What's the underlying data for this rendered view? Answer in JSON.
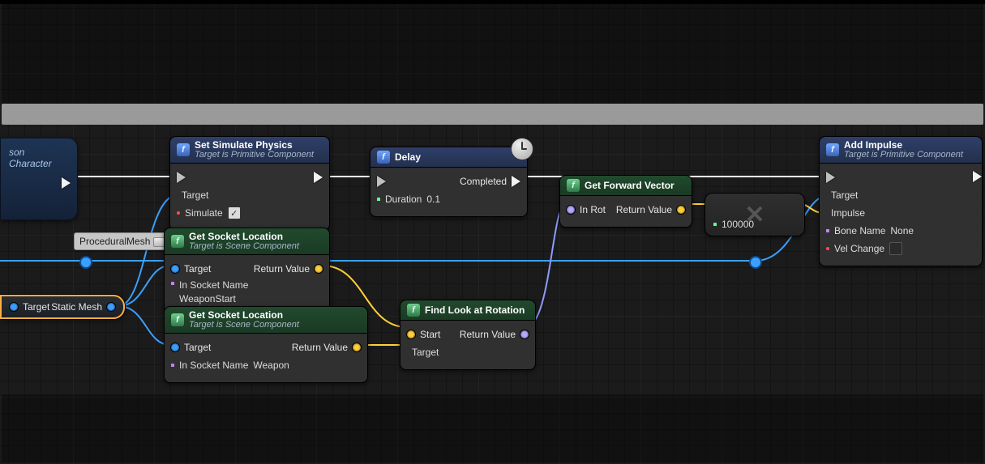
{
  "cast": {
    "title": "son Character"
  },
  "chip": {
    "label": "ProceduralMesh"
  },
  "selected_component": {
    "target_label": "Target",
    "out_label": "Static Mesh"
  },
  "set_sim": {
    "title": "Set Simulate Physics",
    "subtitle": "Target is Primitive Component",
    "target_label": "Target",
    "simulate_label": "Simulate",
    "simulate_checked": "✓"
  },
  "socket1": {
    "title": "Get Socket Location",
    "subtitle": "Target is Scene Component",
    "target_label": "Target",
    "socket_label": "In Socket Name",
    "socket_value": "WeaponStart",
    "return_label": "Return Value"
  },
  "socket2": {
    "title": "Get Socket Location",
    "subtitle": "Target is Scene Component",
    "target_label": "Target",
    "socket_label": "In Socket Name",
    "socket_value": "Weapon",
    "return_label": "Return Value"
  },
  "delay": {
    "title": "Delay",
    "duration_label": "Duration",
    "duration_value": "0.1",
    "completed_label": "Completed"
  },
  "lookat": {
    "title": "Find Look at Rotation",
    "start_label": "Start",
    "target_label": "Target",
    "return_label": "Return Value"
  },
  "forward": {
    "title": "Get Forward Vector",
    "in_label": "In Rot",
    "return_label": "Return Value"
  },
  "multiply": {
    "b_value": "100000"
  },
  "impulse": {
    "title": "Add Impulse",
    "subtitle": "Target is Primitive Component",
    "target_label": "Target",
    "impulse_label": "Impulse",
    "bone_label": "Bone Name",
    "bone_value": "None",
    "vel_label": "Vel Change"
  }
}
